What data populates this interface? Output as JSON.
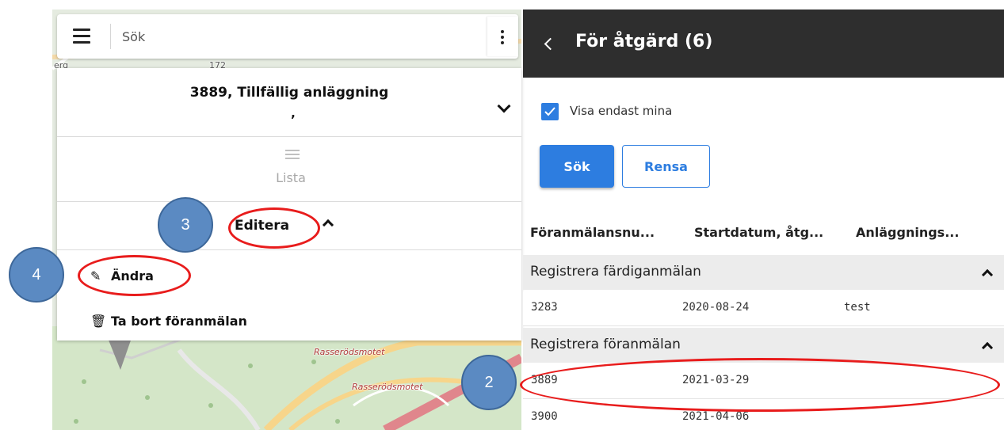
{
  "map": {
    "labels": [
      "Rasserödsmotet",
      "Rasserödsmotet"
    ],
    "road_fragments": [
      "erg",
      "172"
    ]
  },
  "left_panel": {
    "search_placeholder": "Sök",
    "title": "3889, Tillfällig anläggning",
    "subtitle": ",",
    "list_label": "Lista",
    "edit_label": "Editera",
    "menu": {
      "change_icon": "✎",
      "change_label": "Ändra",
      "delete_icon": "🗑",
      "delete_label": "Ta bort föranmälan"
    }
  },
  "right_panel": {
    "title": "För åtgärd (6)",
    "checkbox_label": "Visa endast mina",
    "checkbox_checked": true,
    "search_button": "Sök",
    "clear_button": "Rensa",
    "columns": [
      "Föranmälansnu...",
      "Startdatum, åtg...",
      "Anläggnings..."
    ],
    "groups": [
      {
        "label": "Registrera färdiganmälan",
        "rows": [
          {
            "nr": "3283",
            "date": "2020-08-24",
            "facility": "test"
          }
        ]
      },
      {
        "label": "Registrera föranmälan",
        "rows": [
          {
            "nr": "3889",
            "date": "2021-03-29",
            "facility": ""
          },
          {
            "nr": "3900",
            "date": "2021-04-06",
            "facility": ""
          }
        ]
      }
    ]
  },
  "annotations": {
    "step2": "2",
    "step3": "3",
    "step4": "4"
  },
  "colors": {
    "accent": "#2d7de0",
    "header_bg": "#2e2e2e",
    "annotation_red": "#e81c1c",
    "badge_blue": "#5b8ac2"
  }
}
